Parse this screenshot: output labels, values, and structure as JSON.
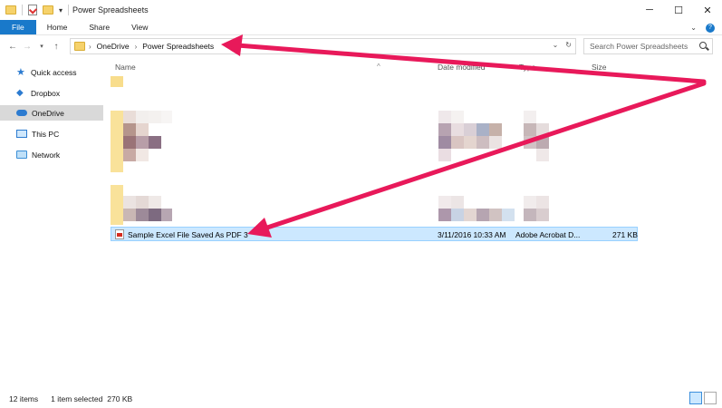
{
  "window": {
    "title": "Power Spreadsheets",
    "controls": {
      "minimize": "─",
      "maximize": "☐",
      "close": "✕"
    }
  },
  "ribbon": {
    "tabs": [
      "File",
      "Home",
      "Share",
      "View"
    ]
  },
  "address": {
    "crumbs": [
      "OneDrive",
      "Power Spreadsheets"
    ],
    "search_placeholder": "Search Power Spreadsheets"
  },
  "nav": {
    "items": [
      {
        "label": "Quick access",
        "icon": "star-icon"
      },
      {
        "label": "Dropbox",
        "icon": "dropbox-icon"
      },
      {
        "label": "OneDrive",
        "icon": "cloud-icon",
        "selected": true
      },
      {
        "label": "This PC",
        "icon": "computer-icon"
      },
      {
        "label": "Network",
        "icon": "network-icon"
      }
    ]
  },
  "columns": {
    "name": "Name",
    "date": "Date modified",
    "type": "Type",
    "size": "Size"
  },
  "selected_file": {
    "name": "Sample Excel File Saved As PDF 3",
    "date": "3/11/2016 10:33 AM",
    "type": "Adobe Acrobat D...",
    "size": "271 KB"
  },
  "status": {
    "count": "12 items",
    "selection": "1 item selected",
    "selection_size": "270 KB"
  },
  "colors": {
    "accent": "#1979ca",
    "selection": "#cce8ff",
    "arrow": "#e8195a"
  }
}
